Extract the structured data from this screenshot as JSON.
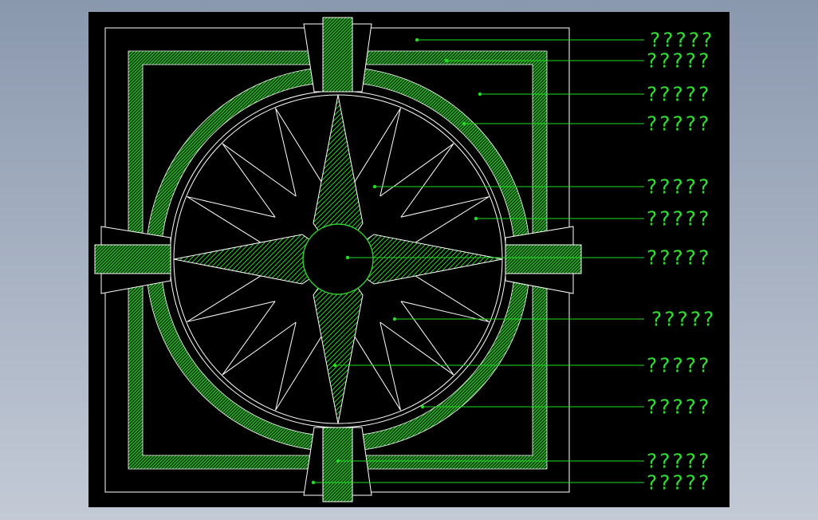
{
  "colors": {
    "background": "#000000",
    "line": "#ffffff",
    "hatch": "#33cc33",
    "leader": "#22dd22",
    "label": "#33dd33"
  },
  "callouts": [
    {
      "text": "?????"
    },
    {
      "text": "?????"
    },
    {
      "text": "?????"
    },
    {
      "text": "?????"
    },
    {
      "text": "?????"
    },
    {
      "text": "?????"
    },
    {
      "text": "?????"
    },
    {
      "text": "?????"
    },
    {
      "text": "?????"
    },
    {
      "text": "?????"
    },
    {
      "text": "?????"
    },
    {
      "text": "?????"
    }
  ]
}
